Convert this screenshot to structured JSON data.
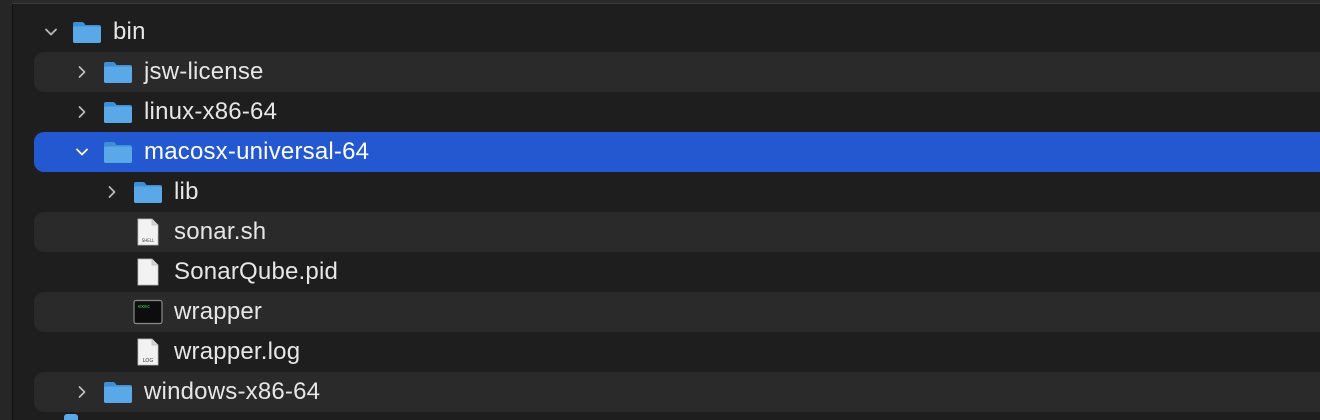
{
  "tree": {
    "items": [
      {
        "name": "bin",
        "kind": "folder",
        "depth": 0,
        "expanded": true,
        "icon": "folder-icon",
        "alt": false,
        "selected": false
      },
      {
        "name": "jsw-license",
        "kind": "folder",
        "depth": 1,
        "expanded": false,
        "icon": "folder-icon",
        "alt": true,
        "selected": false
      },
      {
        "name": "linux-x86-64",
        "kind": "folder",
        "depth": 1,
        "expanded": false,
        "icon": "folder-icon",
        "alt": false,
        "selected": false
      },
      {
        "name": "macosx-universal-64",
        "kind": "folder",
        "depth": 1,
        "expanded": true,
        "icon": "folder-icon",
        "alt": false,
        "selected": true
      },
      {
        "name": "lib",
        "kind": "folder",
        "depth": 2,
        "expanded": false,
        "icon": "folder-icon",
        "alt": false,
        "selected": false
      },
      {
        "name": "sonar.sh",
        "kind": "file",
        "depth": 2,
        "icon": "shell-script-icon",
        "icon_text": "SHELL",
        "alt": true,
        "selected": false
      },
      {
        "name": "SonarQube.pid",
        "kind": "file",
        "depth": 2,
        "icon": "document-icon",
        "alt": false,
        "selected": false
      },
      {
        "name": "wrapper",
        "kind": "file",
        "depth": 2,
        "icon": "terminal-executable-icon",
        "icon_text": "exec",
        "alt": true,
        "selected": false
      },
      {
        "name": "wrapper.log",
        "kind": "file",
        "depth": 2,
        "icon": "log-file-icon",
        "icon_text": "LOG",
        "alt": false,
        "selected": false
      },
      {
        "name": "windows-x86-64",
        "kind": "folder",
        "depth": 1,
        "expanded": false,
        "icon": "folder-icon",
        "alt": true,
        "selected": false
      }
    ]
  },
  "colors": {
    "background": "#1e1e1e",
    "alt_row": "#2a2a2a",
    "selection": "#2458d1",
    "folder": "#5aa8e8",
    "text": "#e6e6e6"
  }
}
